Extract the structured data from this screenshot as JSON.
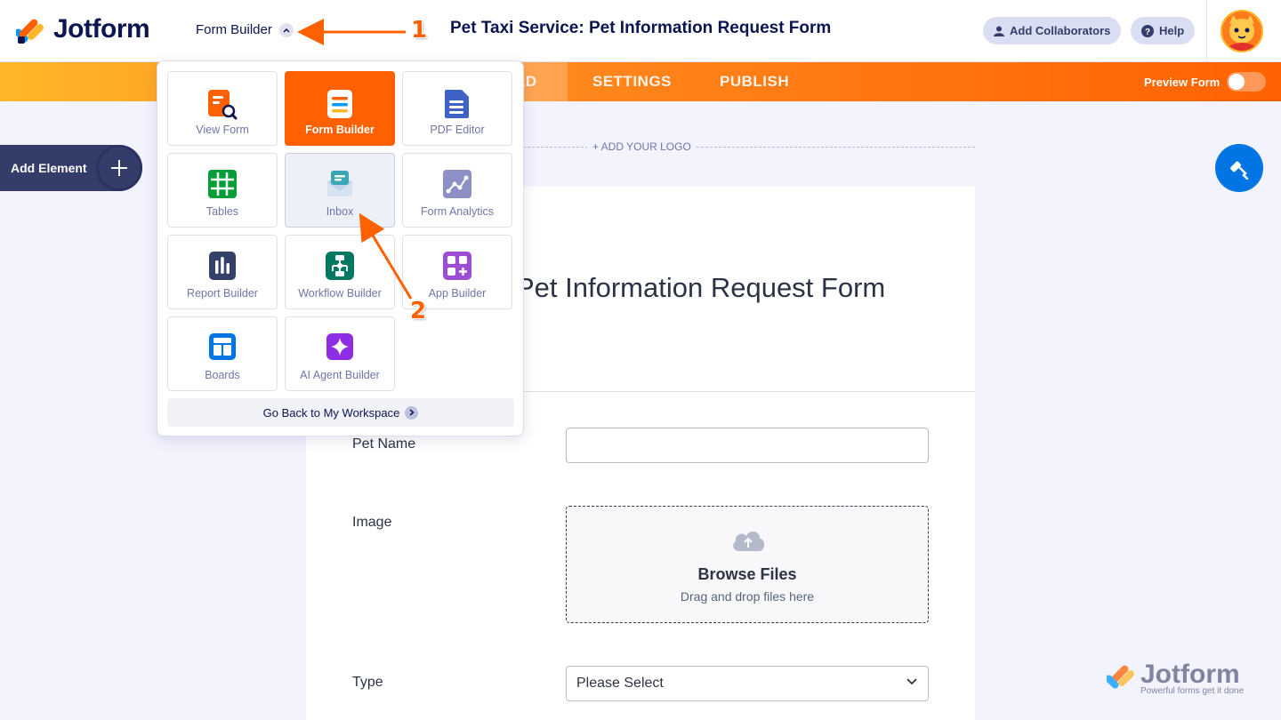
{
  "header": {
    "logo_text": "Jotform",
    "switcher_label": "Form Builder",
    "form_title": "Pet Taxi Service: Pet Information Request Form",
    "add_collaborators": "Add Collaborators",
    "help": "Help"
  },
  "nav": {
    "build": "LD",
    "settings": "SETTINGS",
    "publish": "PUBLISH",
    "preview_form": "Preview Form"
  },
  "sidebar": {
    "add_element": "Add Element"
  },
  "form": {
    "add_logo": "+ ADD YOUR LOGO",
    "heading": "Pet Information Request Form",
    "fields": {
      "pet_name_label": "Pet Name",
      "image_label": "Image",
      "browse_files": "Browse Files",
      "drag_drop": "Drag and drop files here",
      "type_label": "Type",
      "type_value": "Please Select"
    }
  },
  "dropdown": {
    "tiles": [
      {
        "label": "View Form",
        "icon": "view-form-icon",
        "color": "#ff6100"
      },
      {
        "label": "Form Builder",
        "icon": "form-builder-icon",
        "color": "#ffffff"
      },
      {
        "label": "PDF Editor",
        "icon": "pdf-editor-icon",
        "color": "#3e62c8"
      },
      {
        "label": "Tables",
        "icon": "tables-icon",
        "color": "#049e38"
      },
      {
        "label": "Inbox",
        "icon": "inbox-icon",
        "color": "#5fb3c7"
      },
      {
        "label": "Form Analytics",
        "icon": "analytics-icon",
        "color": "#8d8fc7"
      },
      {
        "label": "Report Builder",
        "icon": "report-builder-icon",
        "color": "#344067"
      },
      {
        "label": "Workflow Builder",
        "icon": "workflow-icon",
        "color": "#007862"
      },
      {
        "label": "App Builder",
        "icon": "app-builder-icon",
        "color": "#9c4dd3"
      },
      {
        "label": "Boards",
        "icon": "boards-icon",
        "color": "#0075e3"
      },
      {
        "label": "AI Agent Builder",
        "icon": "ai-agent-icon",
        "color": "#8d2ee4"
      }
    ],
    "workspace_link": "Go Back to My Workspace"
  },
  "watermark": {
    "name": "Jotform",
    "tagline": "Powerful forms get it done"
  },
  "annotations": {
    "step1": "1",
    "step2": "2"
  },
  "colors": {
    "brand_orange": "#ff6100",
    "navy": "#0a1551",
    "accent_blue": "#0075e3"
  }
}
